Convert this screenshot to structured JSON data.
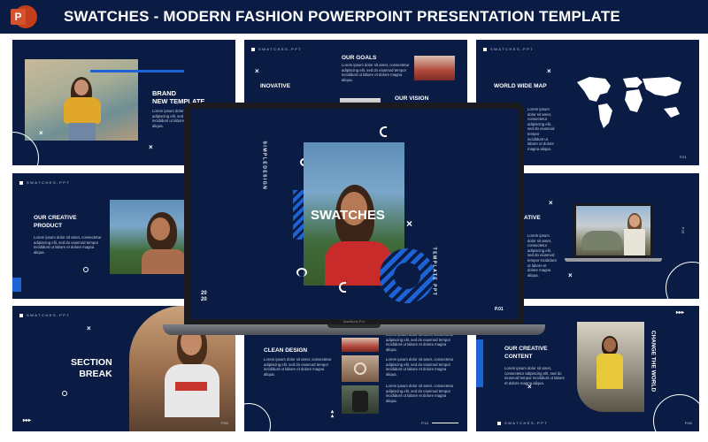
{
  "header": {
    "title": "SWATCHES - MODERN FASHION POWERPOINT PRESENTATION TEMPLATE",
    "app_icon": "powerpoint-icon",
    "app_letter": "P"
  },
  "brand_tag": "SWATCHES-PPT",
  "lorem": "Lorem ipsum dolor sit amet, consectetur adipiscing elit, sed do eiusmod tempor incididunt ut labore et dolore magna aliqua.",
  "slides": {
    "brand": {
      "title_line1": "BRAND",
      "title_line2": "NEW TEMPLATE"
    },
    "goals": {
      "title": "OUR GOALS",
      "inovative": "INOVATIVE",
      "vision": "OUR VISION"
    },
    "map": {
      "title": "WORLD WIDE MAP",
      "page": "P.21"
    },
    "creative_product": {
      "title_line1": "OUR CREATIVE",
      "title_line2": "PRODUCT"
    },
    "creative_laptop": {
      "title": "ATIVE",
      "page": "P.16"
    },
    "section_break": {
      "title_line1": "SECTION",
      "title_line2": "BREAK",
      "page": "P.09"
    },
    "clean_design": {
      "title": "CLEAN DESIGN",
      "page": "P.13"
    },
    "creative_content": {
      "title_line1": "OUR CREATIVE",
      "title_line2": "CONTENT",
      "side": "CHANGE THE WORLD",
      "page": "P.06"
    },
    "cover": {
      "title": "SWATCHES",
      "left_vertical": "SIMPLEDESIGN",
      "right_vertical": "TEMPLATE PPT",
      "year_top": "20",
      "year_bottom": "20",
      "page": "P.01"
    }
  },
  "laptop": {
    "label": "MacBook Pro"
  },
  "colors": {
    "navy": "#0a1c44",
    "accent_blue": "#1e63d6",
    "white": "#ffffff"
  }
}
